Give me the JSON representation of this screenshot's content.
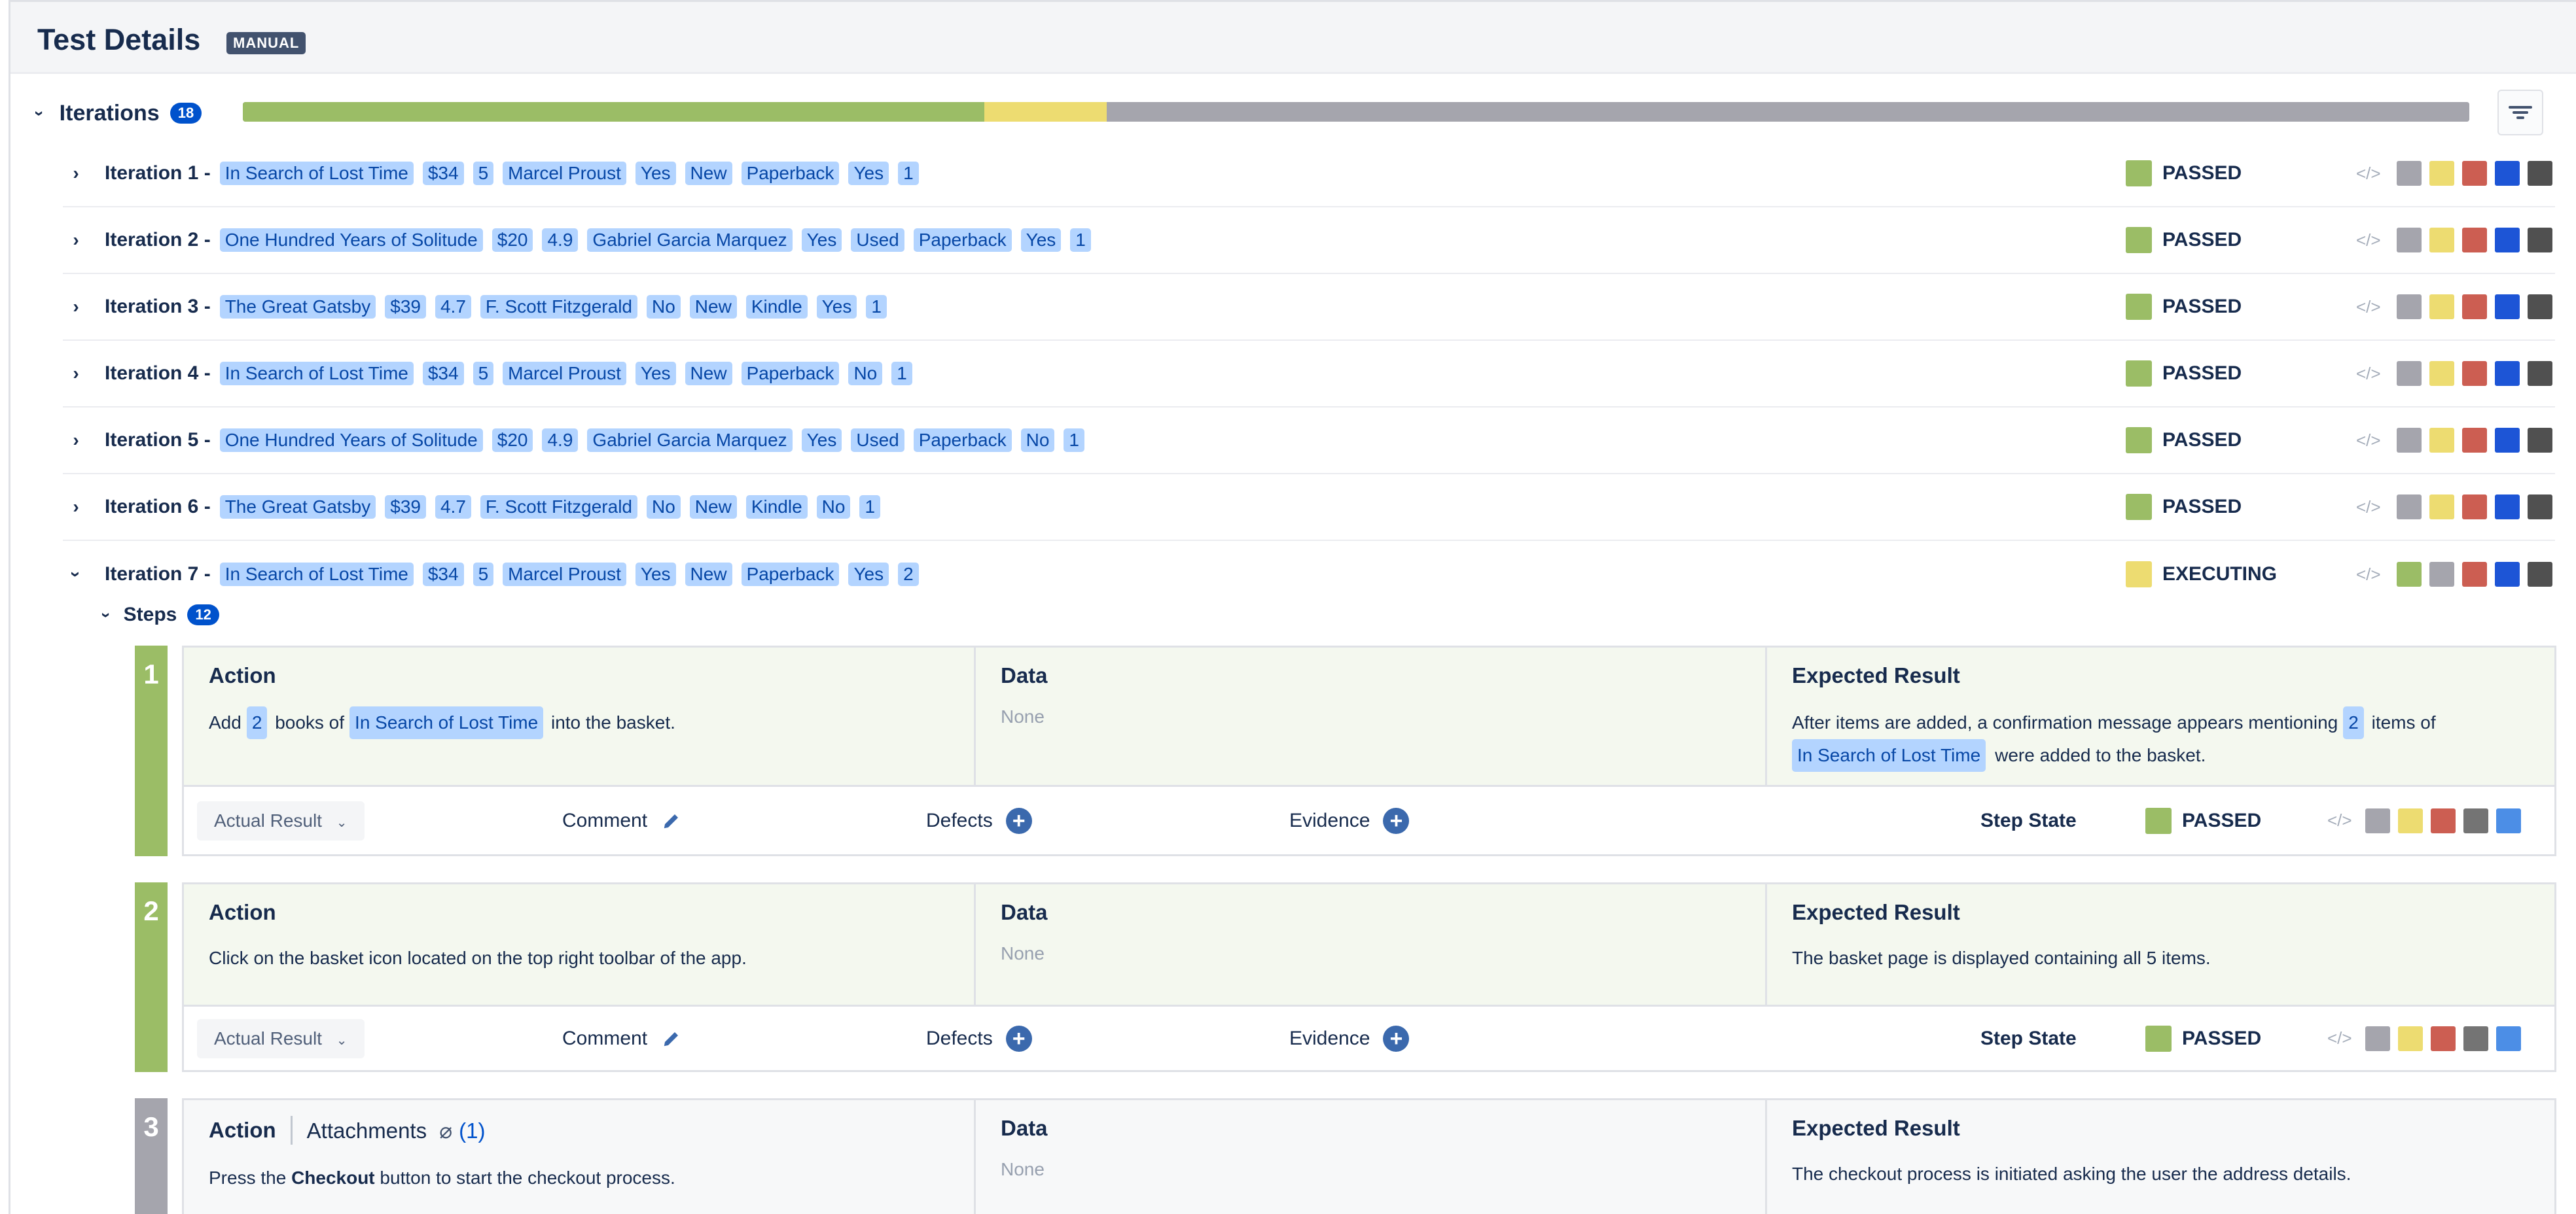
{
  "header": {
    "title": "Test Details",
    "badge": "MANUAL"
  },
  "iterations_section": {
    "label": "Iterations",
    "count": "18",
    "progress": [
      {
        "color": "#9bbd66",
        "fraction": 0.333
      },
      {
        "color": "#eddc71",
        "fraction": 0.055
      },
      {
        "color": "#a5a5ad",
        "fraction": 0.612
      }
    ]
  },
  "colors": {
    "passed": "#9bbd66",
    "executing": "#eddc71",
    "grey": "#a5a5ad",
    "red": "#cc5e52",
    "blue": "#1d55d6",
    "dark": "#505050",
    "steel": "#747474",
    "lightblue": "#4c8ee6"
  },
  "iterations": [
    {
      "name": "Iteration 1 -",
      "tags": [
        "In Search of Lost Time",
        "$34",
        "5",
        "Marcel Proust",
        "Yes",
        "New",
        "Paperback",
        "Yes",
        "1"
      ],
      "status": "PASSED"
    },
    {
      "name": "Iteration 2 -",
      "tags": [
        "One Hundred Years of Solitude",
        "$20",
        "4.9",
        "Gabriel Garcia Marquez",
        "Yes",
        "Used",
        "Paperback",
        "Yes",
        "1"
      ],
      "status": "PASSED"
    },
    {
      "name": "Iteration 3 -",
      "tags": [
        "The Great Gatsby",
        "$39",
        "4.7",
        "F. Scott Fitzgerald",
        "No",
        "New",
        "Kindle",
        "Yes",
        "1"
      ],
      "status": "PASSED"
    },
    {
      "name": "Iteration 4 -",
      "tags": [
        "In Search of Lost Time",
        "$34",
        "5",
        "Marcel Proust",
        "Yes",
        "New",
        "Paperback",
        "No",
        "1"
      ],
      "status": "PASSED"
    },
    {
      "name": "Iteration 5 -",
      "tags": [
        "One Hundred Years of Solitude",
        "$20",
        "4.9",
        "Gabriel Garcia Marquez",
        "Yes",
        "Used",
        "Paperback",
        "No",
        "1"
      ],
      "status": "PASSED"
    },
    {
      "name": "Iteration 6 -",
      "tags": [
        "The Great Gatsby",
        "$39",
        "4.7",
        "F. Scott Fitzgerald",
        "No",
        "New",
        "Kindle",
        "No",
        "1"
      ],
      "status": "PASSED"
    },
    {
      "name": "Iteration 7 -",
      "tags": [
        "In Search of Lost Time",
        "$34",
        "5",
        "Marcel Proust",
        "Yes",
        "New",
        "Paperback",
        "Yes",
        "2"
      ],
      "status": "EXECUTING"
    }
  ],
  "steps_section": {
    "label": "Steps",
    "count": "12"
  },
  "steps": [
    {
      "number": "1",
      "action_title": "Action",
      "data_title": "Data",
      "expected_title": "Expected Result",
      "action_pre": "Add",
      "action_tag1": "2",
      "action_mid": "books of",
      "action_tag2": "In Search of Lost Time",
      "action_post": "into the basket.",
      "data": "None",
      "expected_pre": "After items are added, a confirmation message appears mentioning",
      "expected_tag1": "2",
      "expected_mid": "items of",
      "expected_tag2": "In Search of Lost Time",
      "expected_post": "were added to the basket.",
      "actual_result": "Actual Result",
      "comment": "Comment",
      "defects": "Defects",
      "evidence": "Evidence",
      "step_state": "Step State",
      "status": "PASSED"
    },
    {
      "number": "2",
      "action_title": "Action",
      "data_title": "Data",
      "expected_title": "Expected Result",
      "action": "Click on the basket icon located on the top right toolbar of the app.",
      "data": "None",
      "expected": "The basket page is displayed containing all 5 items.",
      "actual_result": "Actual Result",
      "comment": "Comment",
      "defects": "Defects",
      "evidence": "Evidence",
      "step_state": "Step State",
      "status": "PASSED"
    },
    {
      "number": "3",
      "action_title": "Action",
      "attachments": "Attachments",
      "attachments_count": "(1)",
      "data_title": "Data",
      "expected_title": "Expected Result",
      "action_pre": "Press the",
      "action_bold": "Checkout",
      "action_post": "button to start the checkout process.",
      "data": "None",
      "expected": "The checkout process is initiated asking the user the address details."
    }
  ]
}
